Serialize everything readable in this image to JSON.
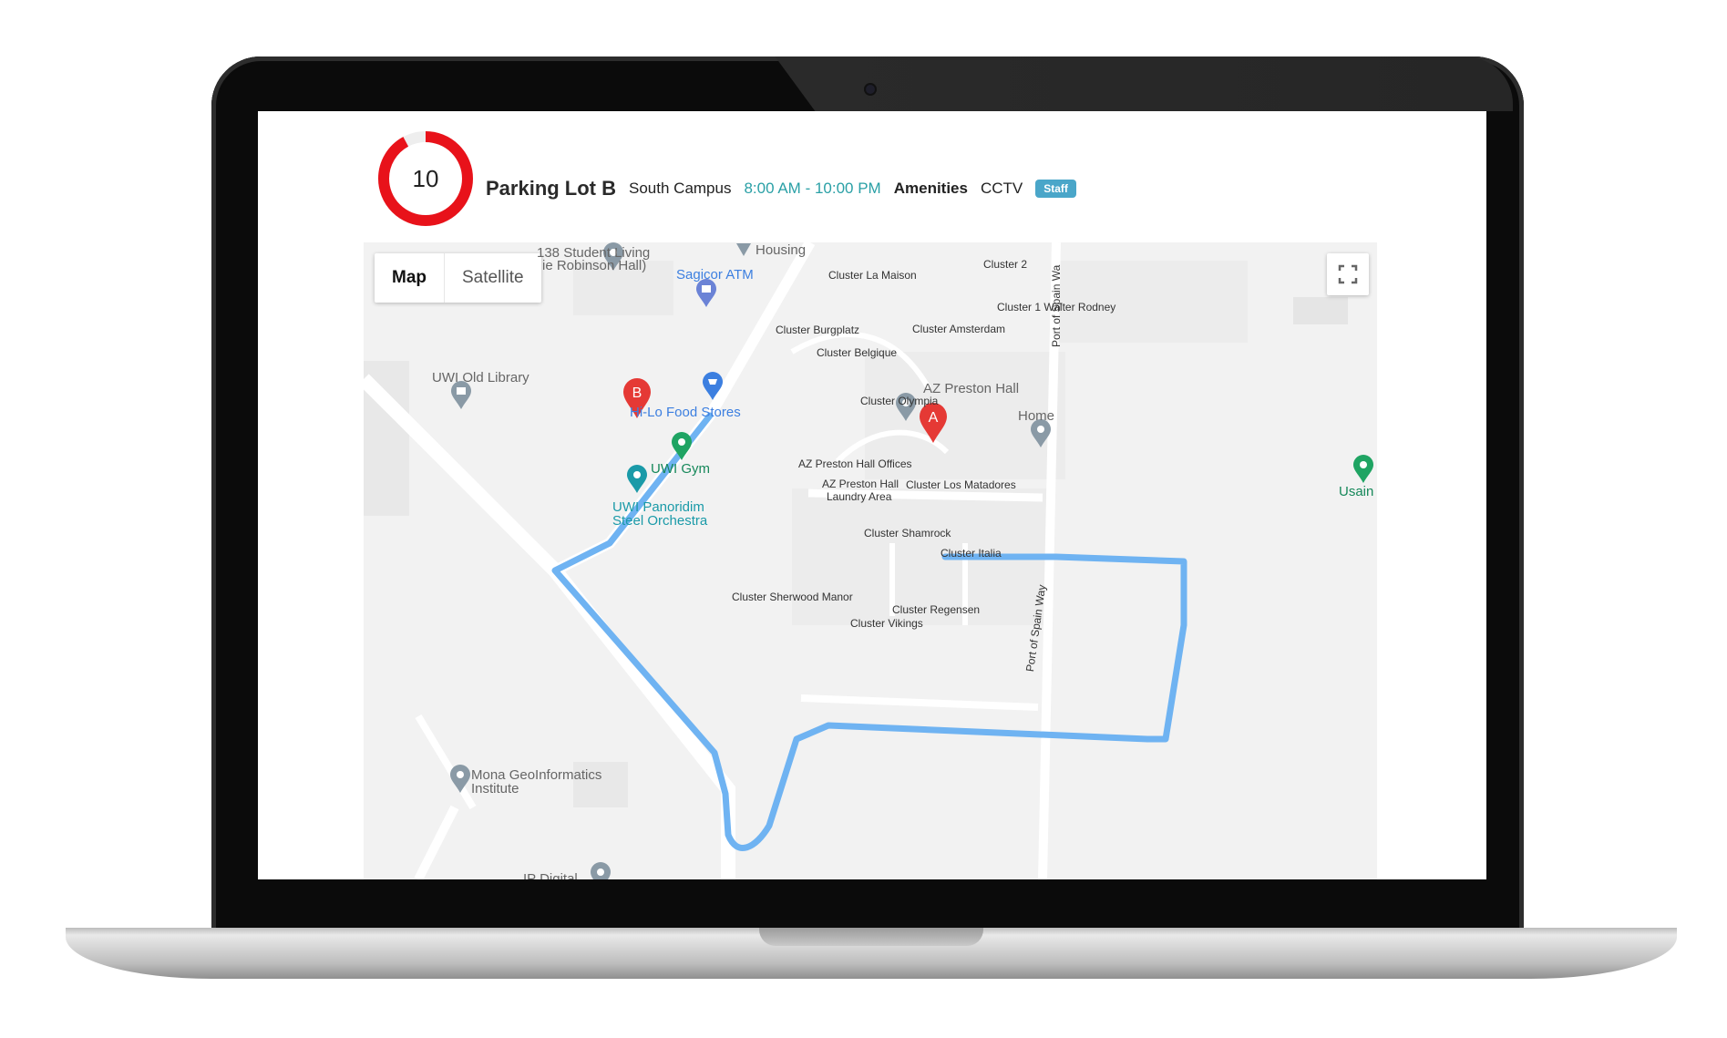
{
  "lot": {
    "spaces_available": "10",
    "occupancy_fraction": 0.92,
    "name": "Parking Lot B",
    "campus": "South Campus",
    "hours": "8:00 AM - 10:00 PM",
    "amenities_label": "Amenities",
    "amenities_value": "CCTV",
    "badge": "Staff"
  },
  "map": {
    "type_buttons": {
      "map": "Map",
      "satellite": "Satellite"
    },
    "markers": {
      "a": "A",
      "b": "B"
    },
    "labels": {
      "student_living_1": "138 Student Living",
      "student_living_2": "ie Robinson Hall)",
      "housing": "Housing",
      "sagicor_atm": "Sagicor ATM",
      "cluster_la_maison": "Cluster La Maison",
      "cluster_2": "Cluster 2",
      "cluster_1": "Cluster 1 Walter Rodney",
      "port_of_spain_top": "Port of Spain Wa",
      "cluster_burgplatz": "Cluster Burgplatz",
      "cluster_amsterdam": "Cluster Amsterdam",
      "cluster_belgique": "Cluster Belgique",
      "uwi_old_library": "UWI Old Library",
      "cluster_olympia": "Cluster Olympia",
      "az_preston_hall": "AZ Preston Hall",
      "hilo_food": "Hi-Lo Food Stores",
      "home": "Home",
      "az_offices": "AZ Preston Hall Offices",
      "uwi_gym": "UWI Gym",
      "az_laundry_1": "AZ Preston Hall",
      "az_laundry_2": "Laundry Area",
      "cluster_los_matadores": "Cluster Los Matadores",
      "usain": "Usain E",
      "uwi_panoridim_1": "UWI Panoridim",
      "uwi_panoridim_2": "Steel Orchestra",
      "cluster_shamrock": "Cluster Shamrock",
      "cluster_italia": "Cluster Italia",
      "port_of_spain_way": "Port of Spain Way",
      "cluster_sherwood": "Cluster Sherwood Manor",
      "cluster_regensen": "Cluster Regensen",
      "cluster_vikings": "Cluster Vikings",
      "mona_geo_1": "Mona GeoInformatics",
      "mona_geo_2": "Institute",
      "ip_digital": "IP Digital"
    }
  },
  "colors": {
    "ring": "#e8121a",
    "hours": "#2aa0a6",
    "badge": "#4aa6c9",
    "route": "#6fb3f2",
    "marker_red": "#e53935"
  }
}
